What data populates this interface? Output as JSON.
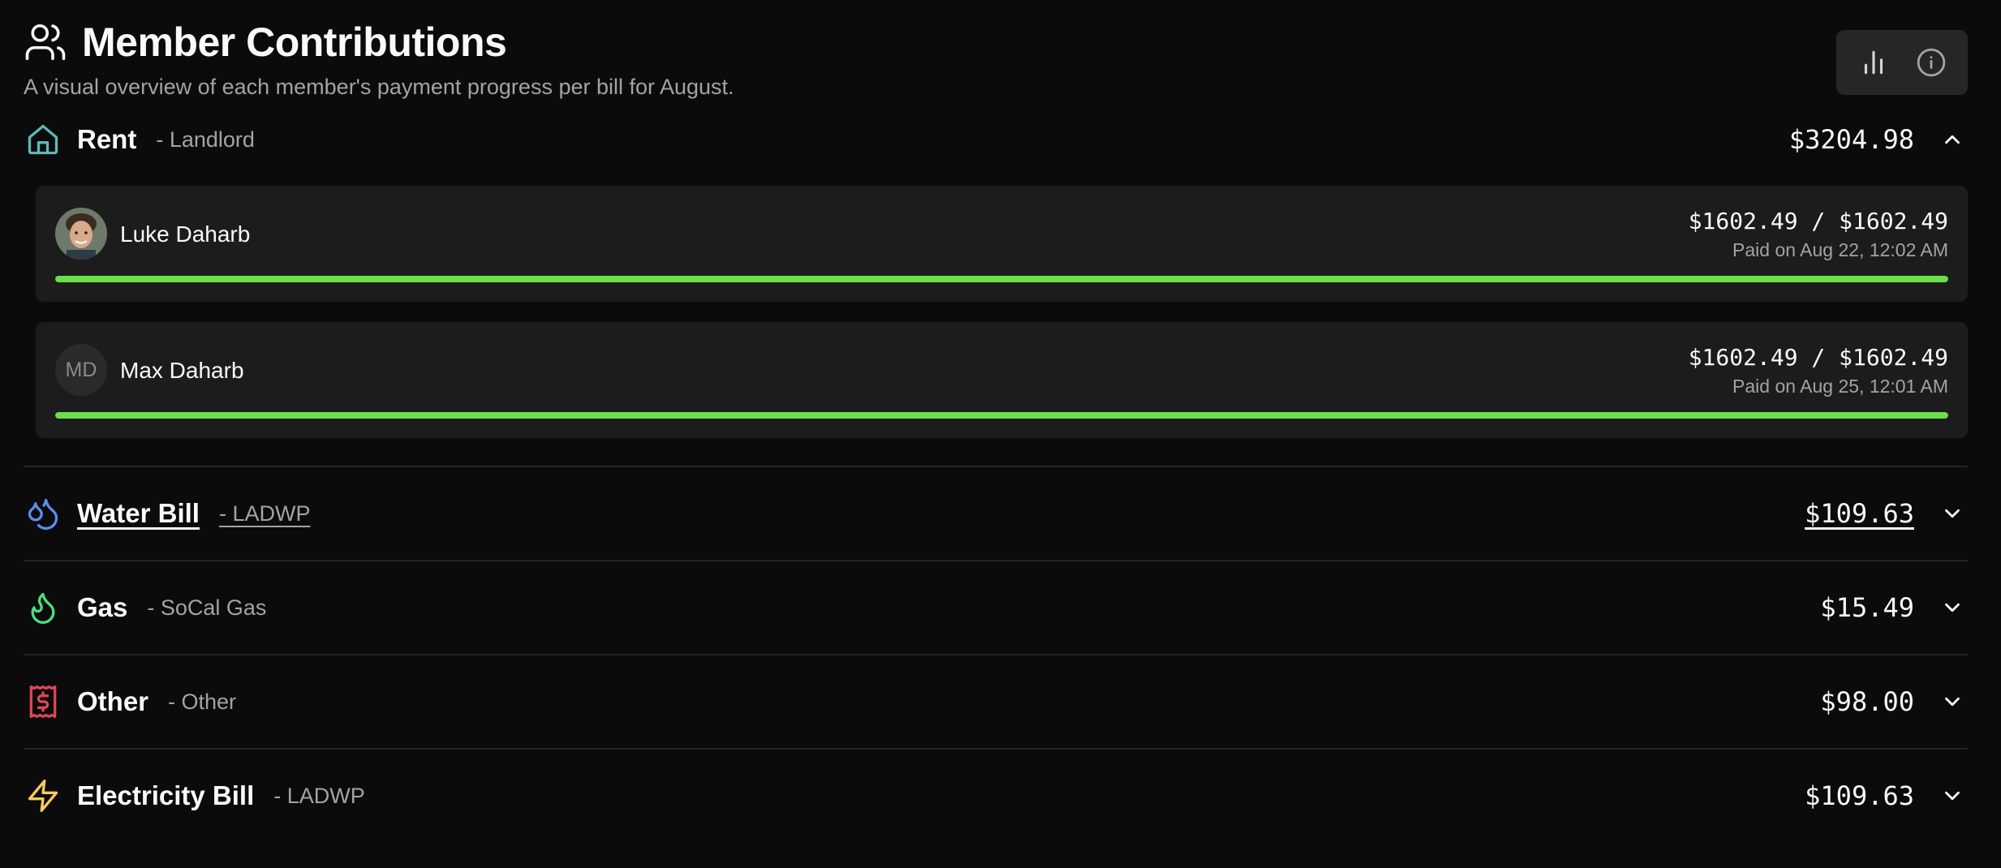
{
  "header": {
    "title": "Member Contributions",
    "subtitle": "A visual overview of each member's payment progress per bill for August.",
    "icons": {
      "title": "users-icon",
      "chart": "bar-chart-icon",
      "info": "info-icon"
    }
  },
  "colors": {
    "background": "#0b0b0b",
    "card": "#1c1c1c",
    "progress": "#6be04a",
    "rent_icon": "#5fb8b8",
    "water_icon": "#5b8def",
    "gas_icon": "#4ade80",
    "other_icon": "#e0455a",
    "electric_icon": "#f5cd5b"
  },
  "bills": [
    {
      "name": "Rent",
      "payee": "- Landlord",
      "amount": "$3204.98",
      "icon": "home-icon",
      "expanded": true,
      "members": [
        {
          "name": "Luke Daharb",
          "amount": "$1602.49 / $1602.49",
          "paid": "Paid on Aug 22, 12:02 AM",
          "progress": 1.0,
          "avatar": "photo"
        },
        {
          "name": "Max Daharb",
          "initials": "MD",
          "amount": "$1602.49 / $1602.49",
          "paid": "Paid on Aug 25, 12:01 AM",
          "progress": 1.0
        }
      ]
    },
    {
      "name": "Water Bill",
      "payee": "- LADWP",
      "amount": "$109.63",
      "icon": "droplets-icon",
      "expanded": false
    },
    {
      "name": "Gas",
      "payee": "- SoCal Gas",
      "amount": "$15.49",
      "icon": "flame-icon",
      "expanded": false
    },
    {
      "name": "Other",
      "payee": "- Other",
      "amount": "$98.00",
      "icon": "receipt-icon",
      "expanded": false
    },
    {
      "name": "Electricity Bill",
      "payee": "- LADWP",
      "amount": "$109.63",
      "icon": "zap-icon",
      "expanded": false
    }
  ]
}
